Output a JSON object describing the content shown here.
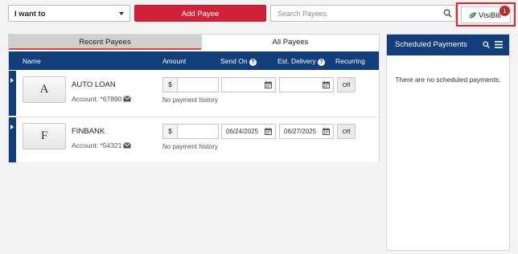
{
  "toolbar": {
    "i_want_to": "I want to",
    "add_payee": "Add Payee",
    "search_placeholder": "Search Payees",
    "visibill_label": "VisiBill",
    "visibill_badge": "1"
  },
  "tabs": [
    "Recent Payees",
    "All Payees"
  ],
  "columns": {
    "name": "Name",
    "amount": "Amount",
    "send_on": "Send On",
    "est_delivery": "Est. Delivery",
    "recurring": "Recurring"
  },
  "payees": [
    {
      "initial": "A",
      "name": "AUTO LOAN",
      "account": "Account: *67890",
      "currency": "$",
      "amount": "",
      "send_on": "",
      "est_delivery": "",
      "recurring": "Off",
      "history": "No payment history"
    },
    {
      "initial": "F",
      "name": "FINBANK",
      "account": "Account: *54321",
      "currency": "$",
      "amount": "",
      "send_on": "06/24/2025",
      "est_delivery": "06/27/2025",
      "recurring": "Off",
      "history": "No payment history"
    }
  ],
  "scheduled": {
    "title": "Scheduled Payments",
    "empty_message": "There are no scheduled payments."
  },
  "colors": {
    "navy": "#123e7c",
    "primary_red": "#d0233a",
    "highlight_red": "#e5222b",
    "badge_red": "#b22f2f",
    "leaf_green": "#2f8a3c"
  },
  "icons": [
    "caret-down-icon",
    "search-icon",
    "leaf-icon",
    "help-icon",
    "calendar-icon",
    "mail-icon",
    "menu-icon",
    "chevron-right-icon"
  ]
}
